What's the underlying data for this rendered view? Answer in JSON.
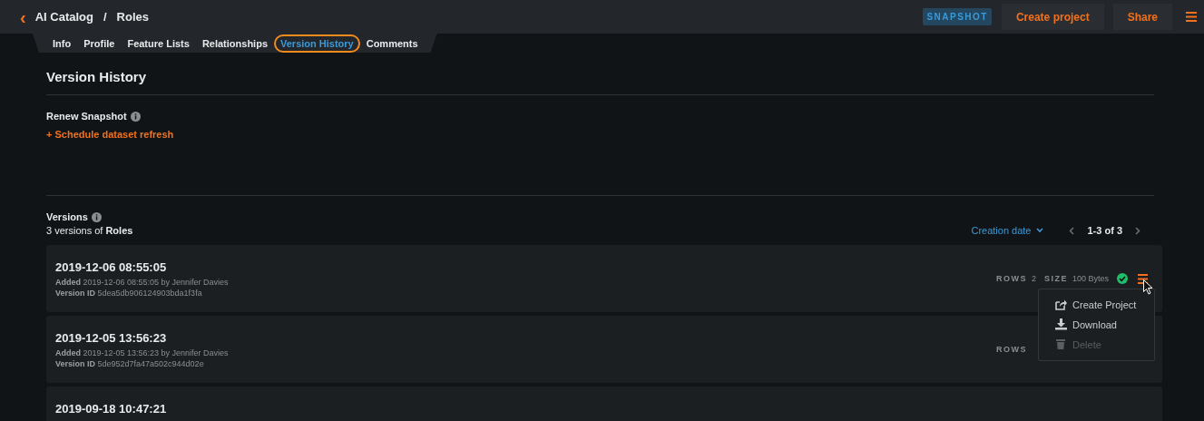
{
  "breadcrumb": {
    "back": "‹",
    "items": [
      "AI Catalog",
      "/",
      "Roles"
    ]
  },
  "header_actions": {
    "badge": "SNAPSHOT",
    "buttons": [
      "Create project",
      "Share"
    ]
  },
  "tabs": [
    {
      "label": "Info",
      "selected": false,
      "outlined": false
    },
    {
      "label": "Profile",
      "selected": false,
      "outlined": false
    },
    {
      "label": "Feature Lists",
      "selected": false,
      "outlined": false
    },
    {
      "label": "Relationships",
      "selected": false,
      "outlined": false
    },
    {
      "label": "Version History",
      "selected": true,
      "outlined": true
    },
    {
      "label": "Comments",
      "selected": false,
      "outlined": false
    }
  ],
  "page_title": "Version History",
  "renew": {
    "label": "Renew Snapshot",
    "link": "+ Schedule dataset refresh"
  },
  "versions": {
    "label": "Versions",
    "summary": "3 versions of **Roles**",
    "sort": "Creation date",
    "pagination": "1-3 of 3",
    "items": [
      {
        "title": "2019-12-06 08:55:05",
        "added": "**Added** 2019-12-06 08:55:05 by Jennifer Davies",
        "version_id": "**Version ID** 5dea5db906124903bda1f3fa",
        "rows_label": "ROWS",
        "rows": "2",
        "size_label": "SIZE",
        "size": "100 Bytes",
        "ok": true,
        "menu_open": true
      },
      {
        "title": "2019-12-05 13:56:23",
        "added": "**Added** 2019-12-05 13:56:23 by Jennifer Davies",
        "version_id": "**Version ID** 5de952d7fa47a502c944d02e",
        "rows_label": "ROWS",
        "ok": false,
        "menu_open": false
      },
      {
        "title": "2019-09-18 10:47:21",
        "ok": false,
        "menu_open": false
      }
    ]
  },
  "menu": [
    {
      "kind": "share",
      "label": "Create Project",
      "disabled": false
    },
    {
      "kind": "download",
      "label": "Download",
      "disabled": false
    },
    {
      "kind": "trash",
      "label": "Delete",
      "disabled": true
    }
  ]
}
